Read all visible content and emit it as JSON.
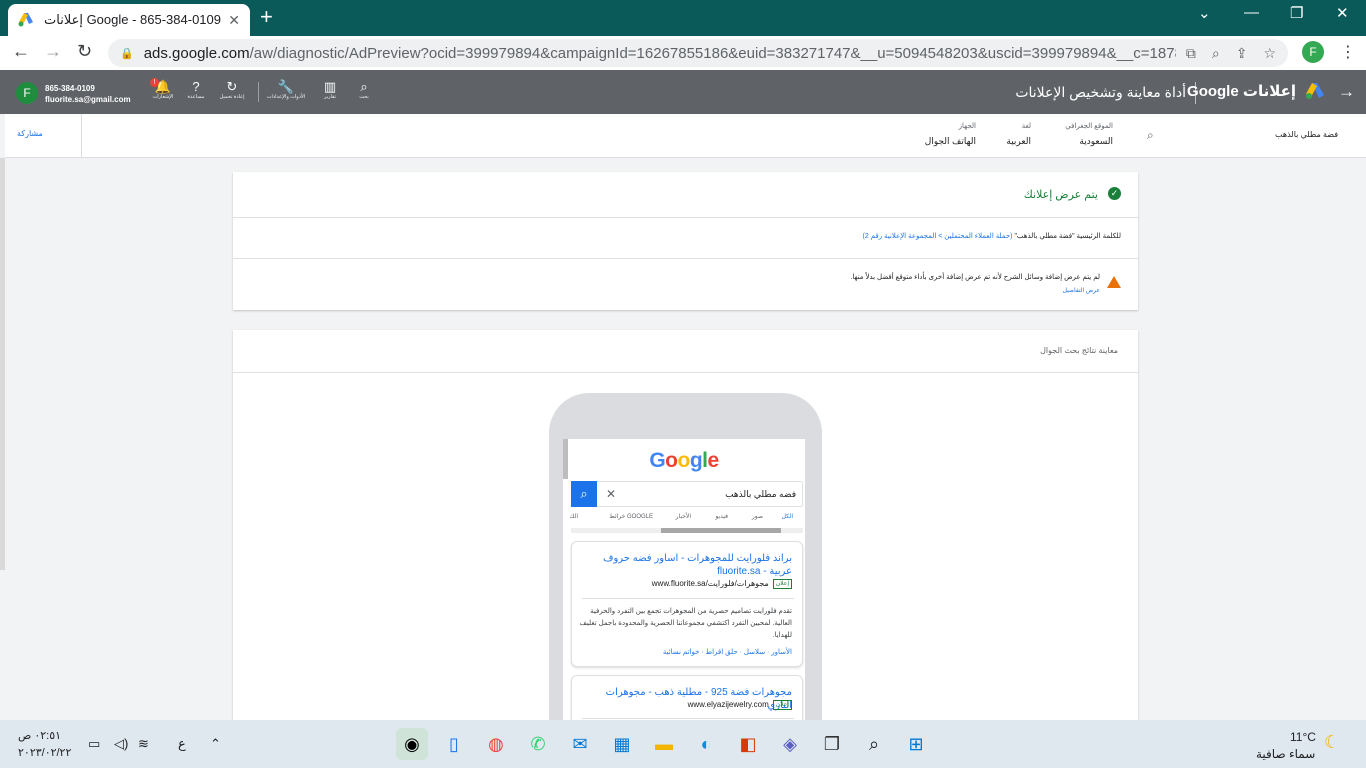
{
  "browser": {
    "tab_title": "إعلانات Google - 865-384-0109",
    "new_tab_label": "+",
    "url_host": "ads.google.com",
    "url_path": "/aw/diagnostic/AdPreview?ocid=399979894&campaignId=16267855186&euid=383271747&__u=5094548203&uscid=399979894&__c=18786000...",
    "profile_initial": "F"
  },
  "ads_header": {
    "account_initial": "F",
    "account_id": "865-384-0109",
    "account_email": "fluorite.sa@gmail.com",
    "tools": [
      {
        "icon": "bell-icon",
        "label": "الإشعارات"
      },
      {
        "icon": "help-icon",
        "label": "مساعدة"
      },
      {
        "icon": "refresh-icon",
        "label": "إعادة تحميل"
      },
      {
        "icon": "wrench-icon",
        "label": "الأدوات والإعدادات"
      },
      {
        "icon": "reports-icon",
        "label": "تقارير"
      },
      {
        "icon": "search-icon",
        "label": "بحث"
      }
    ],
    "notification_count": "!",
    "page_title": "أداة معاينة وتشخيص الإعلانات",
    "brand": "إعلانات Google"
  },
  "settings_bar": {
    "share_label": "مشاركة",
    "device_caption": "الجهاز",
    "device_value": "الهاتف الجوال",
    "language_caption": "لغة",
    "language_value": "العربية",
    "location_caption": "الموقع الجغرافي",
    "location_value": "السعودية",
    "keyword": "فضة مطلي بالذهب"
  },
  "status_card": {
    "status": "يتم عرض إعلانك",
    "keyword_prefix": "للكلمة الرئيسية \"فضة مطلي بالذهب\"",
    "keyword_link": "(حملة العملاء المحتملين > المجموعة الإعلانية رقم 2)",
    "warning": "لم يتم عرض إضافة وسائل الشرح لأنه تم عرض إضافة أخرى بأداء متوقع أفضل بدلاً منها.",
    "details_link": "عرض التفاصيل"
  },
  "preview_card": {
    "title": "معاينة نتائج بحث الجوال",
    "search_query": "فضه مطلي بالذهب",
    "tabs": [
      "الكل",
      "صور",
      "فيديو",
      "الأخبار",
      "خرائط GOOGLE",
      "الك"
    ],
    "ads": [
      {
        "headline": "براند فلورايت للمجوهرات - اساور فضه حروف عربية - fluorite.sa",
        "tag": "إعلان",
        "display_url": "مجوهرات/فلورايت/www.fluorite.sa",
        "description": "تقدم فلورايت تصاميم حصرية من المجوهرات تجمع بين التفرد والحرفية العالية. لمحبين التفرد اكتشفي مجموعاتنا الحصرية والمحدودة باجمل تغليف للهدايا.",
        "sitelinks": "الأساور · سلاسل · حلق اقراط · خواتم نسائية"
      },
      {
        "headline": "مجوهرات فضة 925 - مطلية ذهب - مجوهرات اليازي",
        "tag": "إعلان",
        "display_url": "www.elyazijewelry.com"
      }
    ]
  },
  "taskbar": {
    "temperature": "11°C",
    "weather": "سماء صافية",
    "time": "٠٢:٥١ ص",
    "date": "٢٠٢٣/٠٢/٢٢",
    "input_lang": "ع"
  }
}
